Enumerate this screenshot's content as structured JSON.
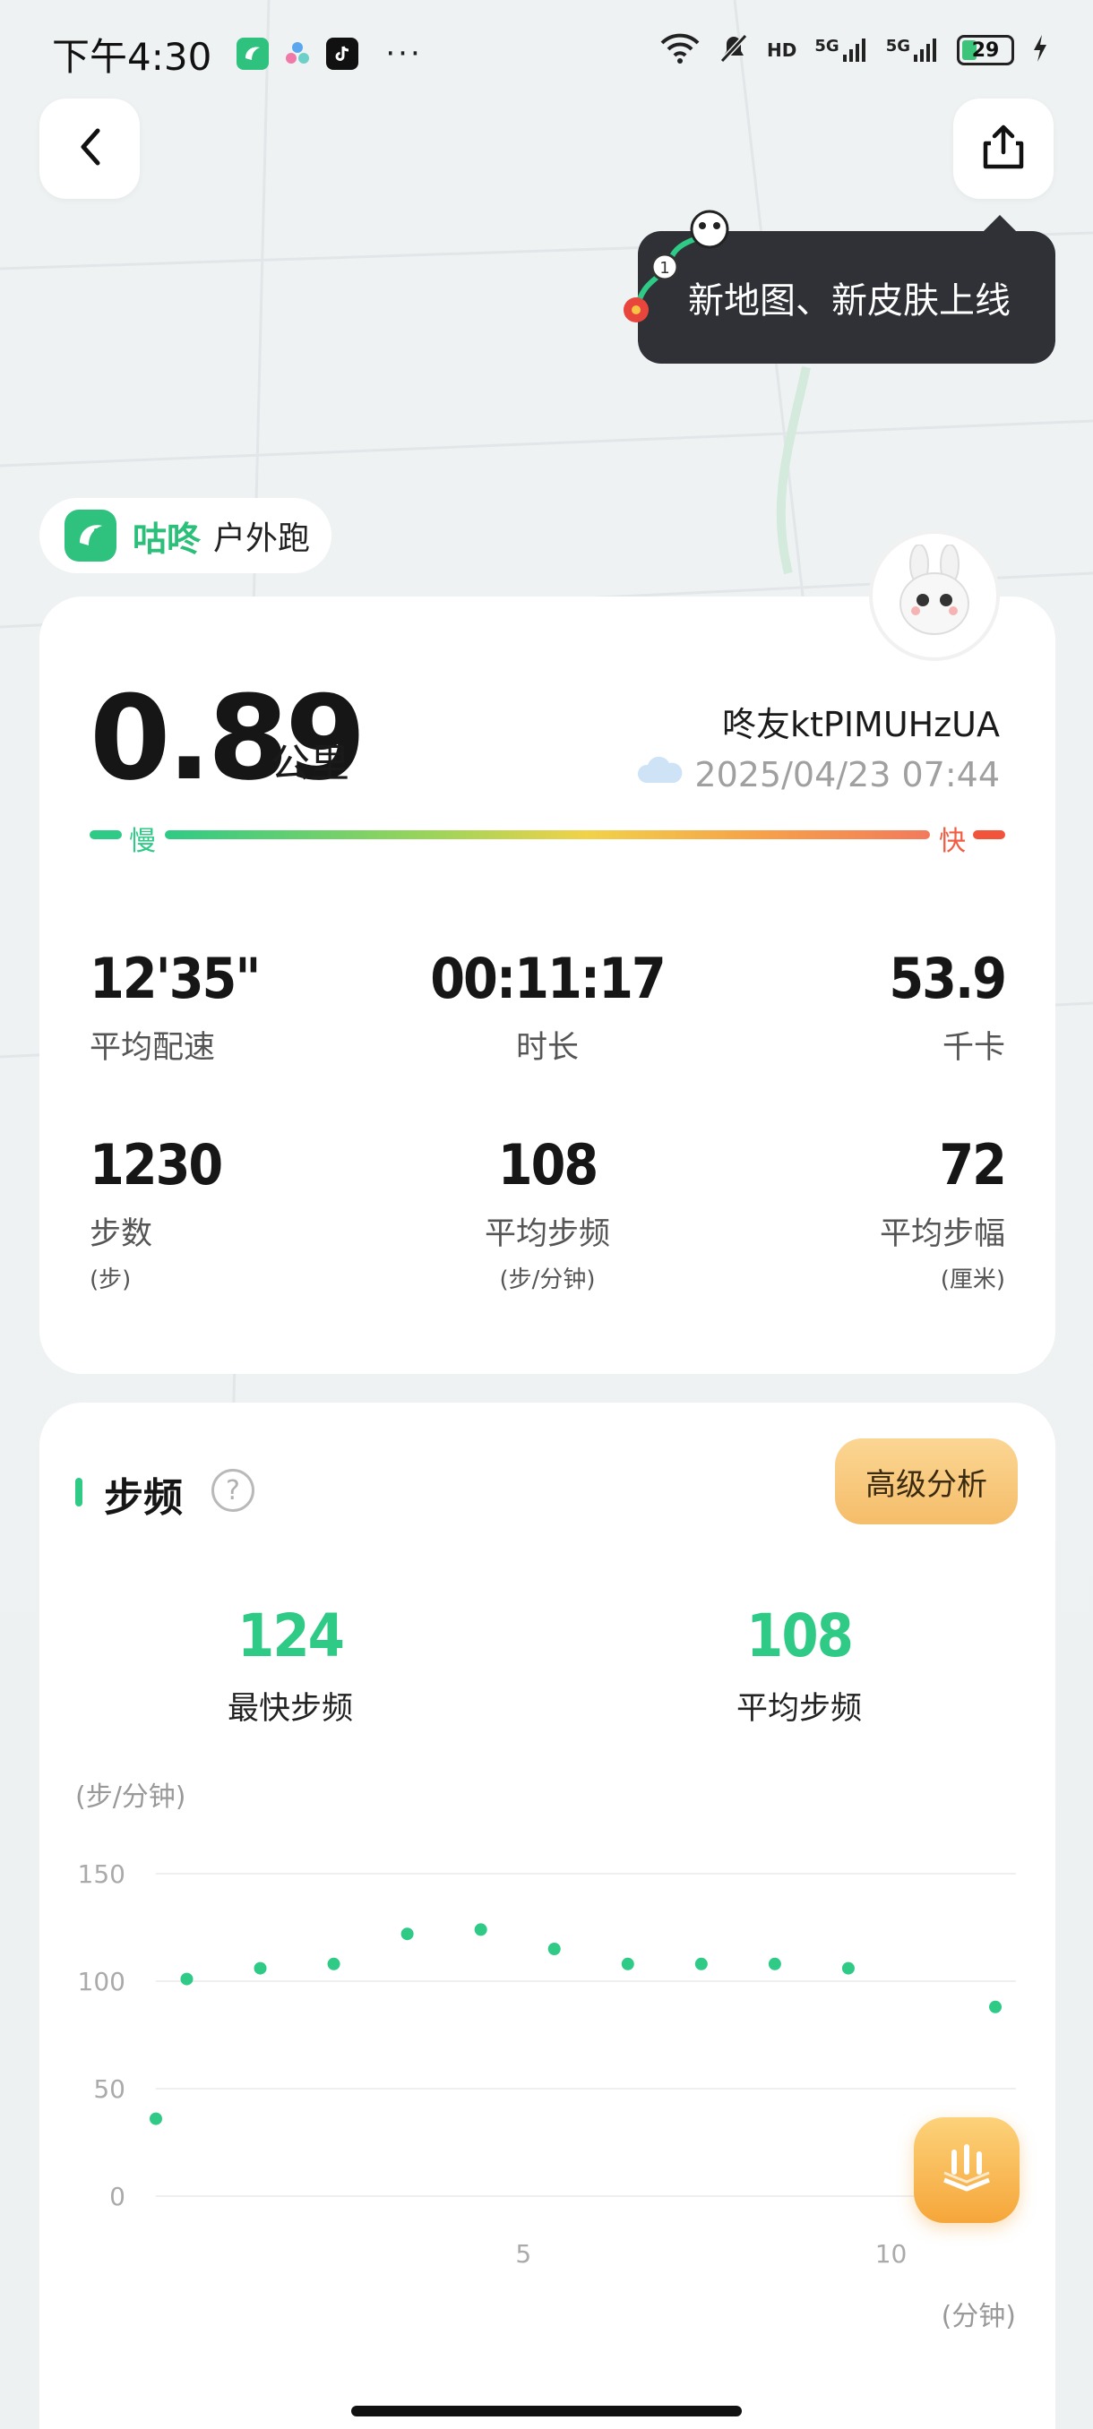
{
  "status_bar": {
    "time": "下午4:30",
    "more": "···",
    "battery": "29",
    "network_5g_1": "5G",
    "network_5g_2": "5G",
    "hd_badge": "HD"
  },
  "tooltip": {
    "text": "新地图、新皮肤上线"
  },
  "source": {
    "brand": "咕咚",
    "type": "户外跑"
  },
  "summary": {
    "distance": "0.89",
    "distance_unit": "公里",
    "username": "咚友ktPIMUHzUA",
    "datetime": "2025/04/23 07:44",
    "speed_slow": "慢",
    "speed_fast": "快"
  },
  "stats": [
    {
      "value": "12'35\"",
      "label": "平均配速",
      "unit": ""
    },
    {
      "value": "00:11:17",
      "label": "时长",
      "unit": ""
    },
    {
      "value": "53.9",
      "label": "千卡",
      "unit": ""
    },
    {
      "value": "1230",
      "label": "步数",
      "unit": "(步)"
    },
    {
      "value": "108",
      "label": "平均步频",
      "unit": "(步/分钟)"
    },
    {
      "value": "72",
      "label": "平均步幅",
      "unit": "(厘米)"
    }
  ],
  "cadence": {
    "title": "步频",
    "advanced_button": "高级分析",
    "help": "?",
    "max_value": "124",
    "max_label": "最快步频",
    "avg_value": "108",
    "avg_label": "平均步频"
  },
  "chart_data": {
    "type": "scatter",
    "ylabel": "(步/分钟)",
    "xlabel": "(分钟)",
    "ylim": [
      0,
      150
    ],
    "yticks": [
      150,
      100,
      50,
      0
    ],
    "xlim": [
      0,
      11.7
    ],
    "xticks": [
      5,
      10
    ],
    "grid": true,
    "color": "#2fca86",
    "x": [
      0,
      0.42,
      1.42,
      2.42,
      3.42,
      4.42,
      5.42,
      6.42,
      7.42,
      8.42,
      9.42,
      11.42
    ],
    "values": [
      36,
      101,
      106,
      108,
      122,
      124,
      115,
      108,
      108,
      108,
      106,
      88
    ]
  }
}
